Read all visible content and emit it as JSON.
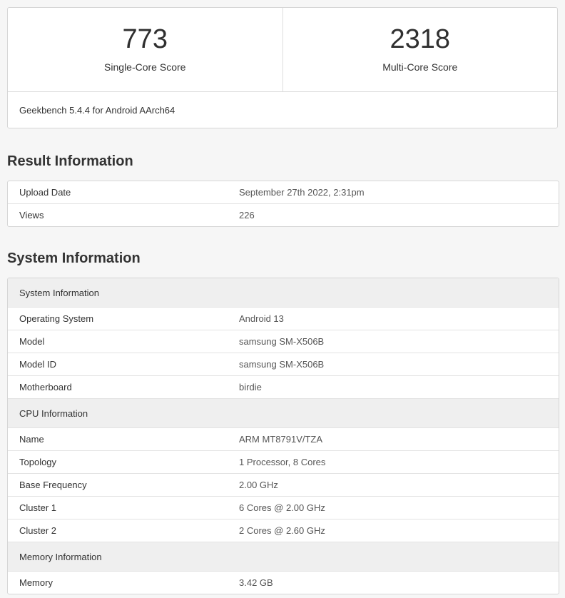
{
  "scores": {
    "single": {
      "value": "773",
      "label": "Single-Core Score"
    },
    "multi": {
      "value": "2318",
      "label": "Multi-Core Score"
    },
    "version": "Geekbench 5.4.4 for Android AArch64"
  },
  "result_information": {
    "title": "Result Information",
    "rows": [
      {
        "key": "Upload Date",
        "value": "September 27th 2022, 2:31pm"
      },
      {
        "key": "Views",
        "value": "226"
      }
    ]
  },
  "system_information": {
    "title": "System Information",
    "groups": [
      {
        "header": "System Information",
        "rows": [
          {
            "key": "Operating System",
            "value": "Android 13"
          },
          {
            "key": "Model",
            "value": "samsung SM-X506B"
          },
          {
            "key": "Model ID",
            "value": "samsung SM-X506B"
          },
          {
            "key": "Motherboard",
            "value": "birdie"
          }
        ]
      },
      {
        "header": "CPU Information",
        "rows": [
          {
            "key": "Name",
            "value": "ARM MT8791V/TZA"
          },
          {
            "key": "Topology",
            "value": "1 Processor, 8 Cores"
          },
          {
            "key": "Base Frequency",
            "value": "2.00 GHz"
          },
          {
            "key": "Cluster 1",
            "value": "6 Cores @ 2.00 GHz"
          },
          {
            "key": "Cluster 2",
            "value": "2 Cores @ 2.60 GHz"
          }
        ]
      },
      {
        "header": "Memory Information",
        "rows": [
          {
            "key": "Memory",
            "value": "3.42 GB"
          }
        ]
      }
    ]
  }
}
